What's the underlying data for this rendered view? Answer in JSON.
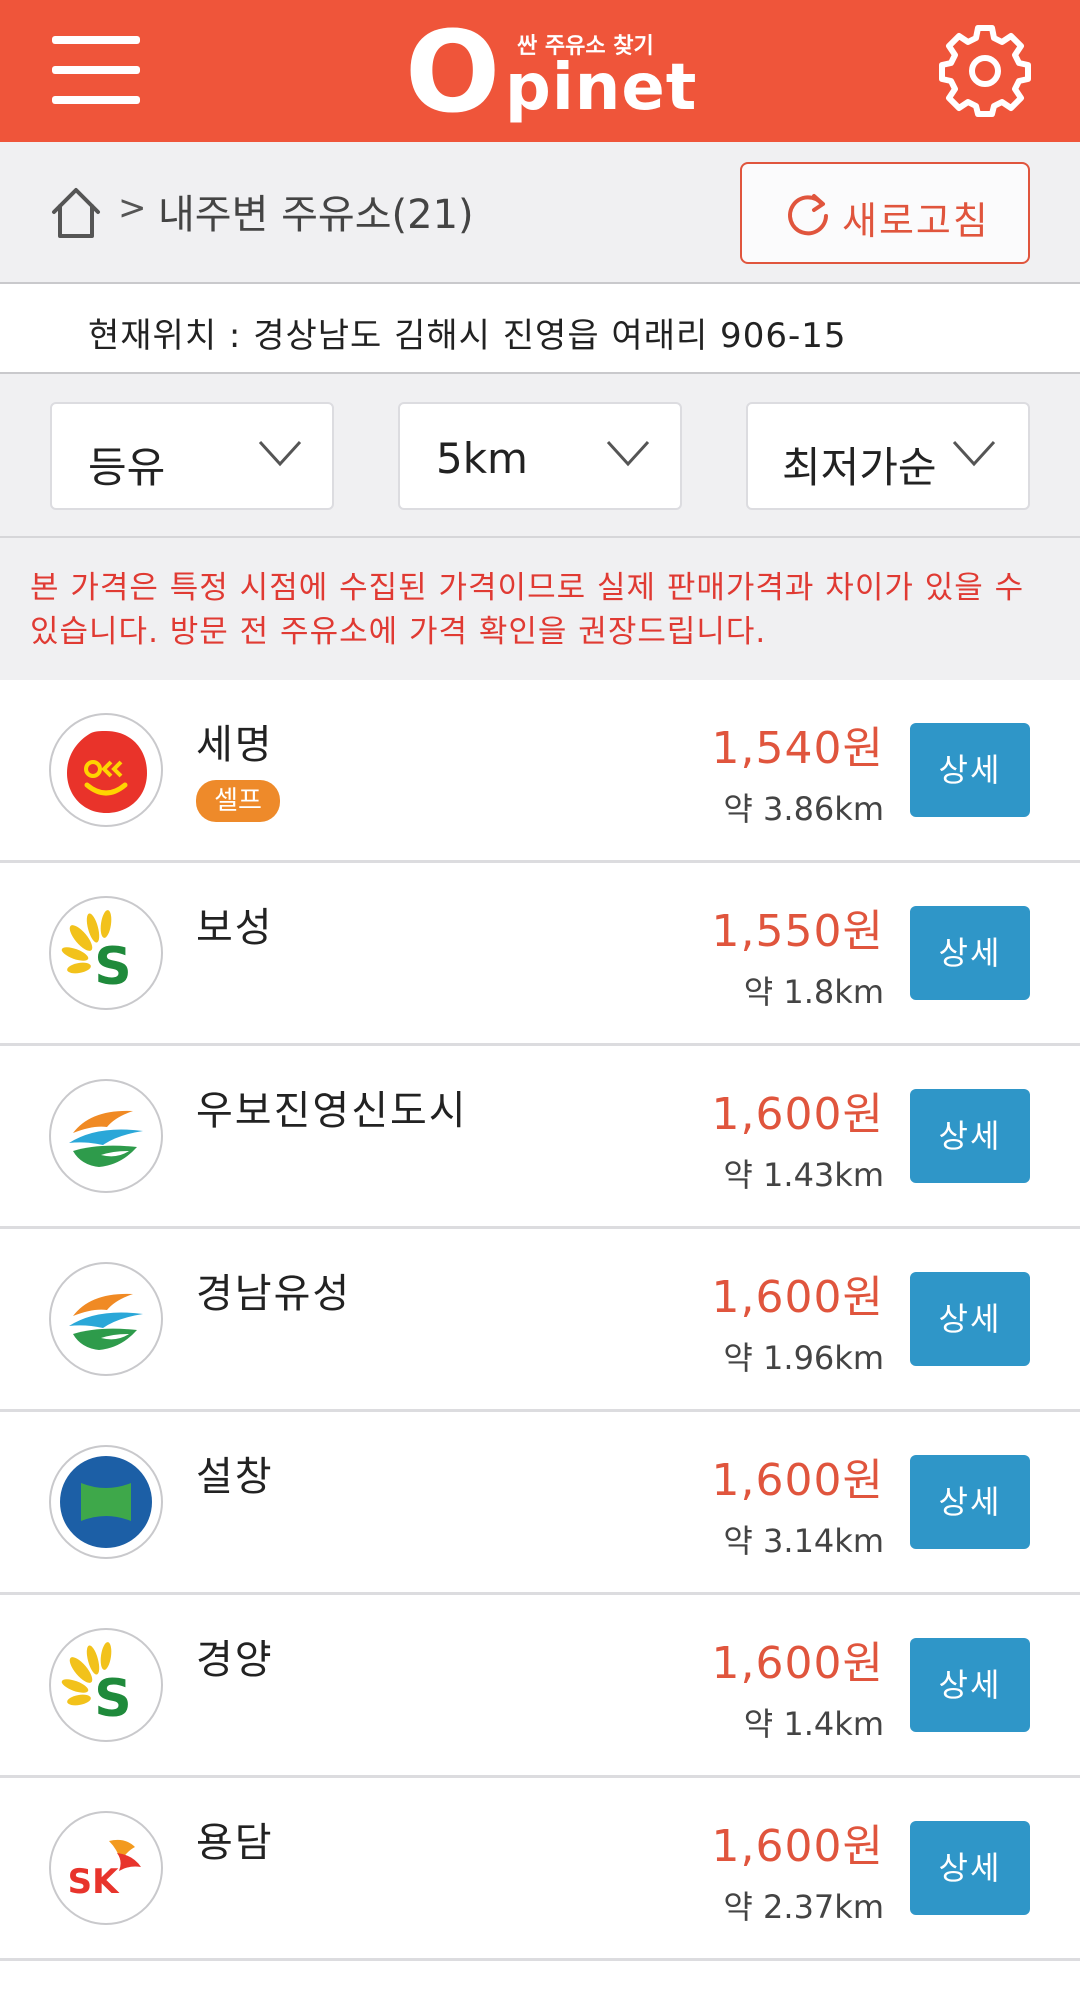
{
  "header": {
    "logo_letter": "O",
    "logo_rest": "pinet",
    "logo_subtitle": "싼 주유소 찾기",
    "brand_color": "#ef553a"
  },
  "breadcrumb": {
    "separator": ">",
    "label": "내주변 주유소(21)",
    "refresh_label": "새로고침"
  },
  "location": {
    "text": "현재위치 : 경상남도 김해시 진영읍 여래리 906-15"
  },
  "filters": {
    "fuel": "등유",
    "radius": "5km",
    "sort": "최저가순"
  },
  "notice": "본 가격은 특정 시점에 수집된 가격이므로 실제 판매가격과 차이가 있을 수 있습니다. 방문 전 주유소에 가격 확인을 권장드립니다.",
  "stations": [
    {
      "name": "세명",
      "badge": "셀프",
      "price": "1,540원",
      "distance": "약 3.86km",
      "brand": "ok-icon",
      "detail_label": "상세"
    },
    {
      "name": "보성",
      "badge": "",
      "price": "1,550원",
      "distance": "약 1.8km",
      "brand": "s-oil-icon",
      "detail_label": "상세"
    },
    {
      "name": "우보진영신도시",
      "badge": "",
      "price": "1,600원",
      "distance": "약 1.43km",
      "brand": "gs-icon",
      "detail_label": "상세"
    },
    {
      "name": "경남유성",
      "badge": "",
      "price": "1,600원",
      "distance": "약 1.96km",
      "brand": "gs-icon",
      "detail_label": "상세"
    },
    {
      "name": "설창",
      "badge": "",
      "price": "1,600원",
      "distance": "약 3.14km",
      "brand": "hyundai-icon",
      "detail_label": "상세"
    },
    {
      "name": "경양",
      "badge": "",
      "price": "1,600원",
      "distance": "약 1.4km",
      "brand": "s-oil-icon",
      "detail_label": "상세"
    },
    {
      "name": "용담",
      "badge": "",
      "price": "1,600원",
      "distance": "약 2.37km",
      "brand": "sk-icon",
      "detail_label": "상세"
    }
  ],
  "colors": {
    "price": "#e0553d",
    "detail_button": "#2f96c8",
    "self_badge": "#ee8a2a",
    "notice": "#e03a33"
  }
}
